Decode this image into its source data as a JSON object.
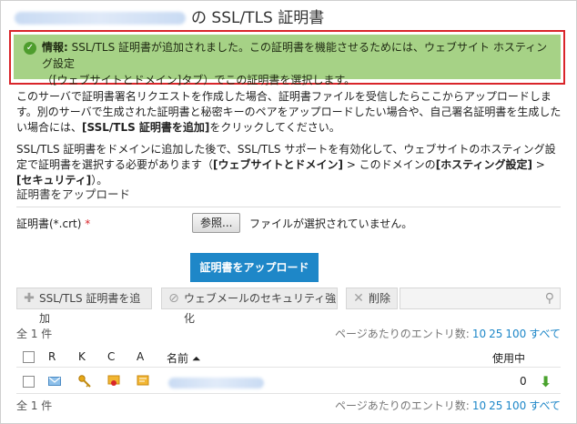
{
  "title": {
    "suffix": "の SSL/TLS 証明書"
  },
  "alert": {
    "label": "情報:",
    "line1": "SSL/TLS 証明書が追加されました。この証明書を機能させるためには、ウェブサイト ホスティング設定",
    "line2": "（[ウェブサイトとドメイン]タブ）でこの証明書を選択します。"
  },
  "intro": {
    "text": "このサーバで証明書署名リクエストを作成した場合、証明書ファイルを受信したらここからアップロードします。別のサーバで生成された証明書と秘密キーのペアをアップロードしたい場合や、自己署名証明書を生成したい場合には、",
    "bold": "[SSL/TLS 証明書を追加]",
    "tail": "をクリックしてください。"
  },
  "help": {
    "text1": "SSL/TLS 証明書をドメインに追加した後で、SSL/TLS サポートを有効化して、ウェブサイトのホスティング設定で証明書を選択する必要があります（",
    "bold1": "[ウェブサイトとドメイン]",
    "text2": " > このドメインの",
    "bold2": "[ホスティング設定]",
    "text3": " > ",
    "bold3": "[セキュリティ]",
    "text4": "）。"
  },
  "upload_section": {
    "heading": "証明書をアップロード",
    "field_label": "証明書(*.crt)",
    "required_mark": "*",
    "browse_label": "参照...",
    "no_file_text": "ファイルが選択されていません。",
    "upload_button": "証明書をアップロード"
  },
  "toolbar": {
    "add_label": "SSL/TLS 証明書を追加",
    "webmail_label": "ウェブメールのセキュリティ強化",
    "delete_label": "削除"
  },
  "list": {
    "total_label": "全 1 件",
    "per_page_label": "ページあたりのエントリ数:",
    "per_page_options": [
      "10",
      "25",
      "100",
      "すべて"
    ],
    "columns": {
      "r": "R",
      "k": "K",
      "c": "C",
      "a": "A",
      "name": "名前 ⏶",
      "in_use": "使用中"
    },
    "rows": [
      {
        "in_use": "0"
      }
    ]
  },
  "colors": {
    "accent": "#1e87c8",
    "alert_bg": "#a6d286",
    "highlight_border": "#d9252a"
  }
}
